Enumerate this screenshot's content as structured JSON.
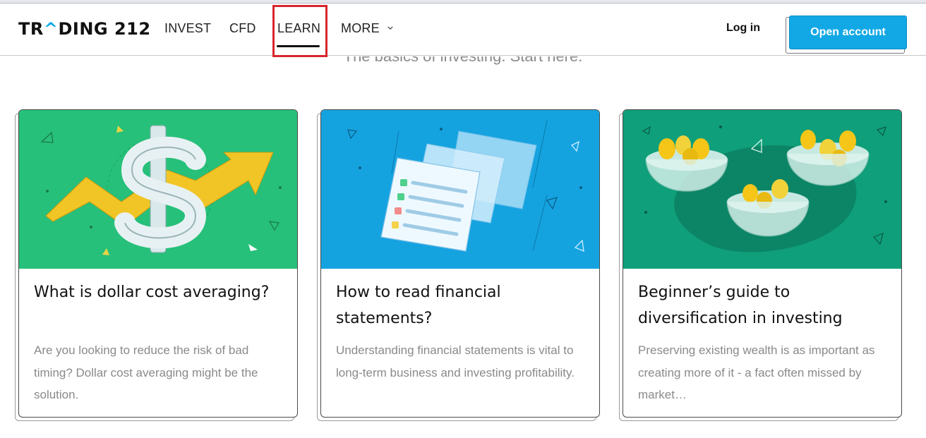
{
  "header": {
    "logo_text": "TR^DING 212",
    "nav": {
      "invest": "INVEST",
      "cfd": "CFD",
      "learn": "LEARN",
      "more": "MORE"
    },
    "active_nav": "LEARN",
    "login_label": "Log in",
    "open_account_label": "Open account"
  },
  "page": {
    "subtitle": "The basics of investing. Start here."
  },
  "cards": [
    {
      "title": "What is dollar cost averaging?",
      "description": "Are you looking to reduce the risk of bad timing? Dollar cost averaging might be the solution.",
      "image": "dollar-sign-arrow-illustration",
      "bg_color": "#27c07a"
    },
    {
      "title": "How to read financial statements?",
      "description": "Understanding financial statements is vital to long-term business and investing profitability.",
      "image": "financial-statements-illustration",
      "bg_color": "#15a3e0"
    },
    {
      "title": "Beginner’s guide to diversification in investing",
      "description": "Preserving existing wealth is as important as creating more of it - a fact often missed by market…",
      "image": "coin-bowls-illustration",
      "bg_color": "#0f9f7a"
    }
  ],
  "colors": {
    "accent": "#12a8e6",
    "highlight": "#d8252c"
  }
}
